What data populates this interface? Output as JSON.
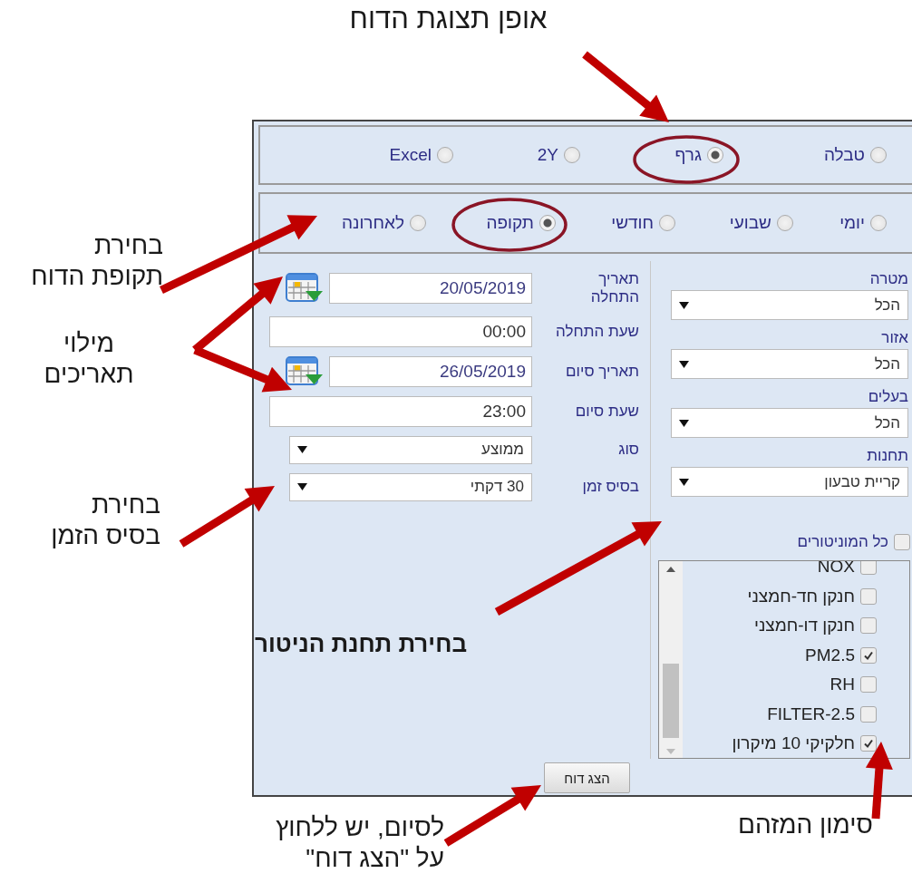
{
  "report_display": {
    "options": [
      {
        "label": "טבלה",
        "selected": false
      },
      {
        "label": "גרף",
        "selected": true
      },
      {
        "label": "2Y",
        "selected": false
      },
      {
        "label": "Excel",
        "selected": false
      }
    ]
  },
  "period": {
    "options": [
      {
        "label": "יומי",
        "selected": false
      },
      {
        "label": "שבועי",
        "selected": false
      },
      {
        "label": "חודשי",
        "selected": false
      },
      {
        "label": "תקופה",
        "selected": true
      },
      {
        "label": "לאחרונה",
        "selected": false
      }
    ]
  },
  "report_fields": [
    {
      "kind": "date",
      "label": "תאריך\nהתחלה",
      "value": "20/05/2019"
    },
    {
      "kind": "text",
      "label": "שעת התחלה",
      "value": "00:00"
    },
    {
      "kind": "date",
      "label": "תאריך סיום",
      "value": "26/05/2019"
    },
    {
      "kind": "text",
      "label": "שעת סיום",
      "value": "23:00"
    },
    {
      "kind": "select",
      "label": "סוג",
      "value": "ממוצע"
    },
    {
      "kind": "select",
      "label": "בסיס זמן",
      "value": "30 דקתי"
    }
  ],
  "filters": [
    {
      "label": "מטרה",
      "value": "הכל"
    },
    {
      "label": "אזור",
      "value": "הכל"
    },
    {
      "label": "בעלים",
      "value": "הכל"
    },
    {
      "label": "תחנות",
      "value": "קריית טבעון"
    }
  ],
  "all_monitors": {
    "label": "כל המוניטורים",
    "checked": false
  },
  "monitors": [
    {
      "label": "NOX",
      "checked": false
    },
    {
      "label": "חנקן חד-חמצני",
      "checked": false
    },
    {
      "label": "חנקן דו-חמצני",
      "checked": false
    },
    {
      "label": "PM2.5",
      "checked": true
    },
    {
      "label": "RH",
      "checked": false
    },
    {
      "label": "FILTER-2.5",
      "checked": false
    },
    {
      "label": "חלקיקי 10 מיקרון",
      "checked": true
    }
  ],
  "submit_button": "הצג דוח",
  "annotations": [
    {
      "text": "אופן תצוגת הדוח"
    },
    {
      "text": "בחירת\nתקופת הדוח"
    },
    {
      "text": "מילוי\nתאריכים"
    },
    {
      "text": "בחירת\nבסיס הזמן"
    },
    {
      "text": "בחירת תחנת הניטור",
      "bold": true
    },
    {
      "text": "סימון המזהם"
    },
    {
      "text": "לסיום, יש ללחוץ\nעל \"הצג דוח\""
    }
  ]
}
